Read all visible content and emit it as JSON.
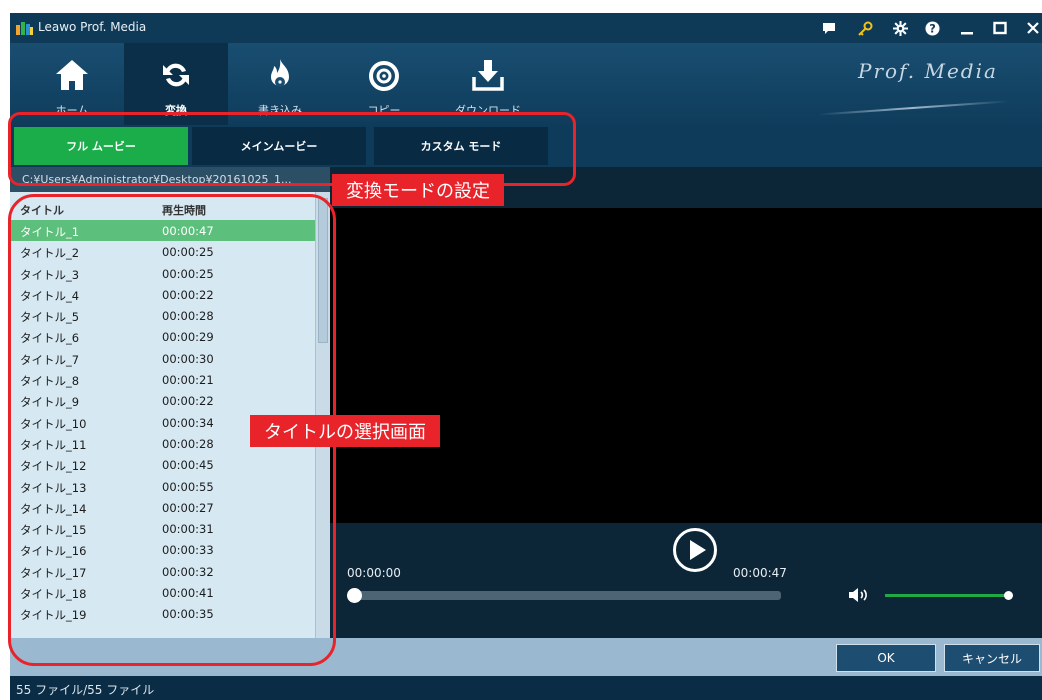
{
  "window": {
    "title": "Leawo Prof. Media",
    "brand": "Prof. Media"
  },
  "titlebar_icons": [
    "chat-icon",
    "key-icon",
    "gear-icon",
    "help-icon",
    "minimize-icon",
    "maximize-icon",
    "close-icon"
  ],
  "nav": [
    {
      "label": "ホーム",
      "icon": "home-icon",
      "active": false
    },
    {
      "label": "変換",
      "icon": "convert-icon",
      "active": true
    },
    {
      "label": "書き込み",
      "icon": "burn-icon",
      "active": false
    },
    {
      "label": "コピー",
      "icon": "copy-disc-icon",
      "active": false
    },
    {
      "label": "ダウンロード",
      "icon": "download-icon",
      "active": false
    }
  ],
  "mode_tabs": [
    {
      "label": "フル ムービー",
      "active": true
    },
    {
      "label": "メインムービー",
      "active": false
    },
    {
      "label": "カスタム モード",
      "active": false
    }
  ],
  "path": "C:¥Users¥Administrator¥Desktop¥20161025_1...",
  "list": {
    "headers": [
      "タイトル",
      "再生時間"
    ],
    "rows": [
      {
        "title": "タイトル_1",
        "duration": "00:00:47",
        "selected": true
      },
      {
        "title": "タイトル_2",
        "duration": "00:00:25"
      },
      {
        "title": "タイトル_3",
        "duration": "00:00:25"
      },
      {
        "title": "タイトル_4",
        "duration": "00:00:22"
      },
      {
        "title": "タイトル_5",
        "duration": "00:00:28"
      },
      {
        "title": "タイトル_6",
        "duration": "00:00:29"
      },
      {
        "title": "タイトル_7",
        "duration": "00:00:30"
      },
      {
        "title": "タイトル_8",
        "duration": "00:00:21"
      },
      {
        "title": "タイトル_9",
        "duration": "00:00:22"
      },
      {
        "title": "タイトル_10",
        "duration": "00:00:34"
      },
      {
        "title": "タイトル_11",
        "duration": "00:00:28"
      },
      {
        "title": "タイトル_12",
        "duration": "00:00:45"
      },
      {
        "title": "タイトル_13",
        "duration": "00:00:55"
      },
      {
        "title": "タイトル_14",
        "duration": "00:00:27"
      },
      {
        "title": "タイトル_15",
        "duration": "00:00:31"
      },
      {
        "title": "タイトル_16",
        "duration": "00:00:33"
      },
      {
        "title": "タイトル_17",
        "duration": "00:00:32"
      },
      {
        "title": "タイトル_18",
        "duration": "00:00:41"
      },
      {
        "title": "タイトル_19",
        "duration": "00:00:35"
      }
    ]
  },
  "player": {
    "current_time": "00:00:00",
    "total_time": "00:00:47",
    "progress": 0,
    "volume": 1.0
  },
  "buttons": {
    "ok": "OK",
    "cancel": "キャンセル"
  },
  "status": "55 ファイル/55 ファイル",
  "annotations": {
    "mode_setting": "変換モードの設定",
    "title_select": "タイトルの選択画面"
  },
  "colors": {
    "accent_green": "#1aad4a",
    "annotation_red": "#e8232a",
    "app_dark": "#0d3550"
  }
}
